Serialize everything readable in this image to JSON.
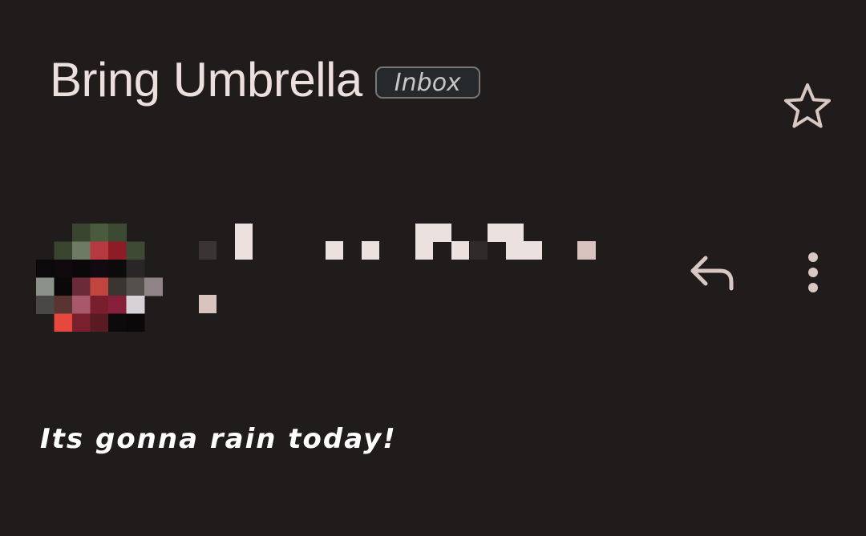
{
  "email": {
    "subject": "Bring Umbrella",
    "label": "Inbox",
    "body": "Its gonna rain today!"
  },
  "icons": {
    "star": "star-outline-icon",
    "reply": "reply-icon",
    "more": "more-vert-icon",
    "avatar": "pixelated-avatar"
  },
  "colors": {
    "background": "#201c1b",
    "text": "#ece0de",
    "icon": "#d9c7c2",
    "chip_border": "#7a7676"
  }
}
